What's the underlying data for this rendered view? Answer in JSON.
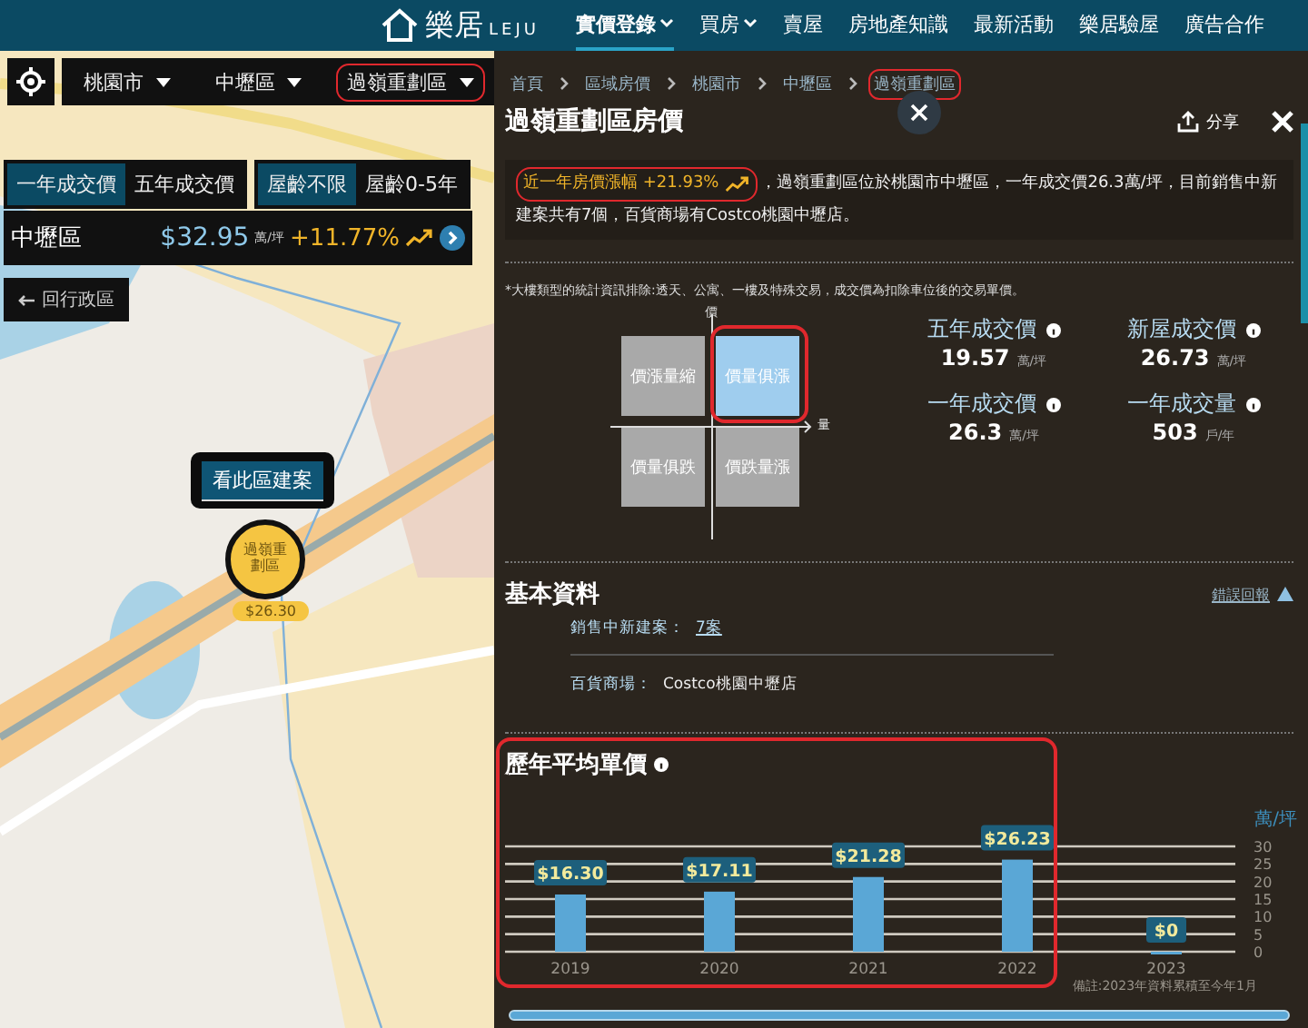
{
  "nav": {
    "logo": "樂居",
    "logo_sub": "LEJU",
    "items": [
      {
        "label": "實價登錄",
        "selected": true,
        "caret": true
      },
      {
        "label": "買房",
        "selected": false,
        "caret": true
      },
      {
        "label": "賣屋",
        "selected": false,
        "caret": false
      },
      {
        "label": "房地產知識",
        "selected": false,
        "caret": false
      },
      {
        "label": "最新活動",
        "selected": false,
        "caret": false
      },
      {
        "label": "樂居驗屋",
        "selected": false,
        "caret": false
      },
      {
        "label": "廣告合作",
        "selected": false,
        "caret": false
      }
    ]
  },
  "map_panel": {
    "selectors": [
      {
        "label": "桃園市",
        "circled": false
      },
      {
        "label": "中壢區",
        "circled": false
      },
      {
        "label": "過嶺重劃區",
        "circled": true
      }
    ],
    "price_tabs": [
      {
        "label": "一年成交價",
        "selected": true
      },
      {
        "label": "五年成交價",
        "selected": false
      }
    ],
    "age_tabs": [
      {
        "label": "屋齡不限",
        "selected": true
      },
      {
        "label": "屋齡0-5年",
        "selected": false
      }
    ],
    "district": {
      "name": "中壢區",
      "price": "$32.95",
      "unit": "萬/坪",
      "change": "+11.77%"
    },
    "back_button": "回行政區",
    "popup": "看此區建案",
    "marker": {
      "name": "過嶺重劃區",
      "price": "$26.30"
    }
  },
  "breadcrumb": [
    {
      "label": "首頁",
      "circled": false
    },
    {
      "label": "區域房價",
      "circled": false
    },
    {
      "label": "桃園市",
      "circled": false
    },
    {
      "label": "中壢區",
      "circled": false
    },
    {
      "label": "過嶺重劃區",
      "circled": true
    }
  ],
  "title": "過嶺重劃區房價",
  "share": "分享",
  "summary": {
    "badge": "近一年房價漲幅 +21.93%",
    "circled": true,
    "text": "，過嶺重劃區位於桃園市中壢區，一年成交價26.3萬/坪，目前銷售中新建案共有7個，百貨商場有Costco桃園中壢店。"
  },
  "note": "*大樓類型的統計資訊排除:透天、公寓、一樓及特殊交易，成交價為扣除車位後的交易單價。",
  "quadrant": {
    "y_axis": "價",
    "x_axis": "量",
    "circled": true,
    "cells": [
      {
        "label": "價漲量縮",
        "selected": false
      },
      {
        "label": "價量俱漲",
        "selected": true
      },
      {
        "label": "價量俱跌",
        "selected": false
      },
      {
        "label": "價跌量漲",
        "selected": false
      }
    ]
  },
  "stats": [
    {
      "label": "五年成交價",
      "value": "19.57",
      "unit": "萬/坪"
    },
    {
      "label": "新屋成交價",
      "value": "26.73",
      "unit": "萬/坪"
    },
    {
      "label": "一年成交價",
      "value": "26.3",
      "unit": "萬/坪"
    },
    {
      "label": "一年成交量",
      "value": "503",
      "unit": "戶/年"
    }
  ],
  "basic_info": {
    "title": "基本資料",
    "report_link": "錯誤回報",
    "rows": [
      {
        "label": "銷售中新建案：",
        "value": "7案",
        "kind": "link"
      },
      {
        "label": "百貨商場：",
        "value": "Costco桃園中壢店",
        "kind": "text"
      }
    ]
  },
  "price_history": {
    "title": "歷年平均單價",
    "circled": true,
    "note": "備註:2023年資料累積至今年1月",
    "chart_data": {
      "type": "bar",
      "grid": true,
      "ylabel": "萬/坪",
      "categories": [
        "2019",
        "2020",
        "2021",
        "2022",
        "2023"
      ],
      "values": [
        16.3,
        17.11,
        21.28,
        26.23,
        0
      ],
      "value_labels": [
        "$16.30",
        "$17.11",
        "$21.28",
        "$26.23",
        "$0"
      ],
      "ylim": [
        0,
        30
      ],
      "yticks": [
        0,
        5,
        10,
        15,
        20,
        25,
        30
      ]
    }
  }
}
